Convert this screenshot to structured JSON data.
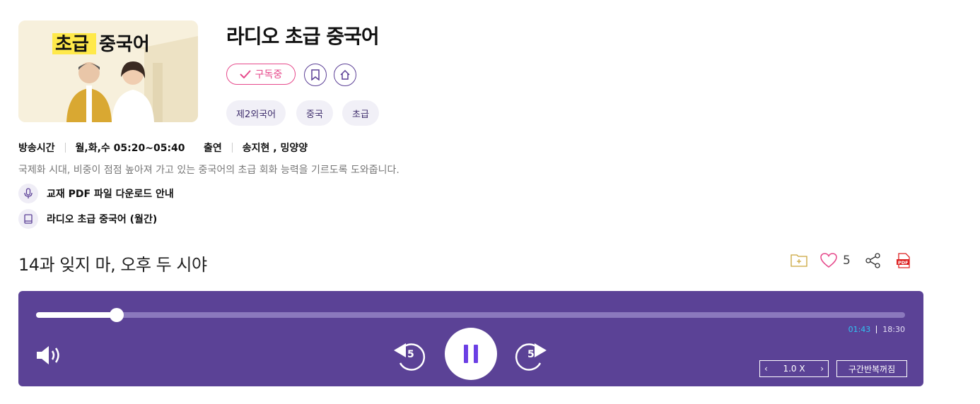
{
  "program": {
    "title": "라디오 초급 중국어",
    "thumbnail_text": [
      "초급",
      "중국어"
    ],
    "subscribe_label": "구독중",
    "tags": [
      "제2외국어",
      "중국",
      "초급"
    ],
    "broadcast_label": "방송시간",
    "broadcast_value": "월,화,수 05:20~05:40",
    "cast_label": "출연",
    "cast_value": "송지현 ,  밍양양",
    "description": "국제화 시대, 비중이 점점 높아져 가고 있는 중국어의 초급 회화 능력을 기르도록 도와줍니다.",
    "resources": [
      "교재 PDF 파일 다운로드 안내",
      "라디오 초급 중국어 (월간)"
    ]
  },
  "episode": {
    "title": "14과 잊지 마, 오후 두 시야",
    "like_count": "5"
  },
  "player": {
    "current_time": "01:43",
    "total_time": "18:30",
    "progress_fraction": 0.0928,
    "rewind_seconds": "5",
    "forward_seconds": "5",
    "speed": "1.0 X",
    "repeat_label": "구간반복꺼짐"
  },
  "colors": {
    "accent_pink": "#e6498b",
    "player_bg": "#5b4296",
    "pause_glyph": "#6b3fe4",
    "current_time": "#2fc4f3"
  }
}
